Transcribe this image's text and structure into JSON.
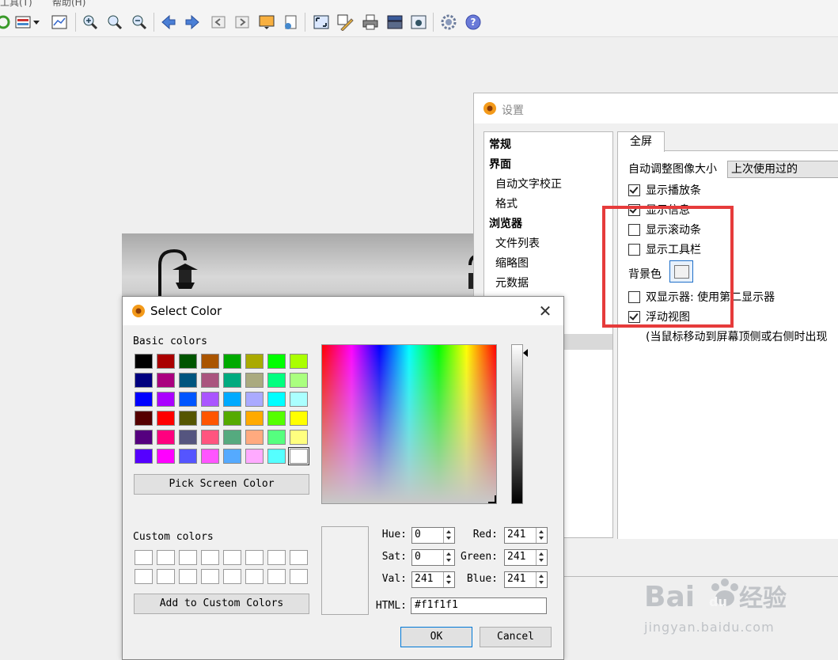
{
  "menubar": {
    "items": [
      "工具(T)",
      "帮助(H)"
    ]
  },
  "toolbar": {
    "icons": [
      "refresh-icon",
      "window-layout-icon",
      "dropdown-arrow-icon",
      "chart-icon",
      "zoom-in-icon",
      "zoom-fit-icon",
      "zoom-out-icon",
      "arrow-left-icon",
      "arrow-right-icon",
      "page-back-icon",
      "page-forward-icon",
      "slideshow-icon",
      "file-info-icon",
      "fullscreen-icon",
      "edit-icon",
      "print-icon",
      "scanner-icon",
      "camera-icon",
      "gear-icon",
      "help-icon"
    ]
  },
  "settings": {
    "title": "设置",
    "list": [
      {
        "label": "常规",
        "bold": true
      },
      {
        "label": "界面",
        "bold": true
      },
      {
        "label": "自动文字校正",
        "bold": false
      },
      {
        "label": "格式",
        "bold": false
      },
      {
        "label": "浏览器",
        "bold": true
      },
      {
        "label": "文件列表",
        "bold": false
      },
      {
        "label": "缩略图",
        "bold": false
      },
      {
        "label": "元数据",
        "bold": false
      }
    ],
    "tab": "全屏",
    "auto_resize_label": "自动调整图像大小",
    "auto_resize_value": "上次使用过的",
    "options": {
      "show_playbar": {
        "label": "显示播放条",
        "checked": true
      },
      "show_info": {
        "label": "显示信息",
        "checked": true
      },
      "show_scrollbar": {
        "label": "显示滚动条",
        "checked": false
      },
      "show_toolbar": {
        "label": "显示工具栏",
        "checked": false
      },
      "dual_monitor": {
        "label": "双显示器: 使用第二显示器",
        "checked": false
      },
      "float_view": {
        "label": "浮动视图",
        "checked": true
      }
    },
    "bg_color_label": "背景色",
    "bg_color_value": "#f1f1f1",
    "float_note": "(当鼠标移动到屏幕顶侧或右侧时出现"
  },
  "color_dialog": {
    "title": "Select Color",
    "basic_colors_label": "Basic colors",
    "basic_colors": [
      "#000000",
      "#aa0000",
      "#005500",
      "#aa5500",
      "#00aa00",
      "#aaaa00",
      "#00ff00",
      "#aaff00",
      "#00007f",
      "#aa007f",
      "#00557f",
      "#aa557f",
      "#00aa7f",
      "#aaaa7f",
      "#00ff7f",
      "#aaff7f",
      "#0000ff",
      "#aa00ff",
      "#0055ff",
      "#aa55ff",
      "#00aaff",
      "#aaaaff",
      "#00ffff",
      "#aaffff",
      "#550000",
      "#ff0000",
      "#555500",
      "#ff5500",
      "#55aa00",
      "#ffaa00",
      "#55ff00",
      "#ffff00",
      "#55007f",
      "#ff007f",
      "#55557f",
      "#ff557f",
      "#55aa7f",
      "#ffaa7f",
      "#55ff7f",
      "#ffff7f",
      "#5500ff",
      "#ff00ff",
      "#5555ff",
      "#ff55ff",
      "#55aaff",
      "#ffaaff",
      "#55ffff",
      "#ffffff"
    ],
    "pick_screen_label": "Pick Screen Color",
    "custom_colors_label": "Custom colors",
    "add_custom_label": "Add to Custom Colors",
    "hue_label": "Hue:",
    "hue": "0",
    "sat_label": "Sat:",
    "sat": "0",
    "val_label": "Val:",
    "val": "241",
    "red_label": "Red:",
    "red": "241",
    "green_label": "Green:",
    "green": "241",
    "blue_label": "Blue:",
    "blue": "241",
    "html_label": "HTML:",
    "html": "#f1f1f1",
    "ok_label": "OK",
    "cancel_label": "Cancel"
  },
  "watermark": {
    "brand": "Bai",
    "brand2": "du",
    "cn": "经验",
    "url": "jingyan.baidu.com"
  }
}
